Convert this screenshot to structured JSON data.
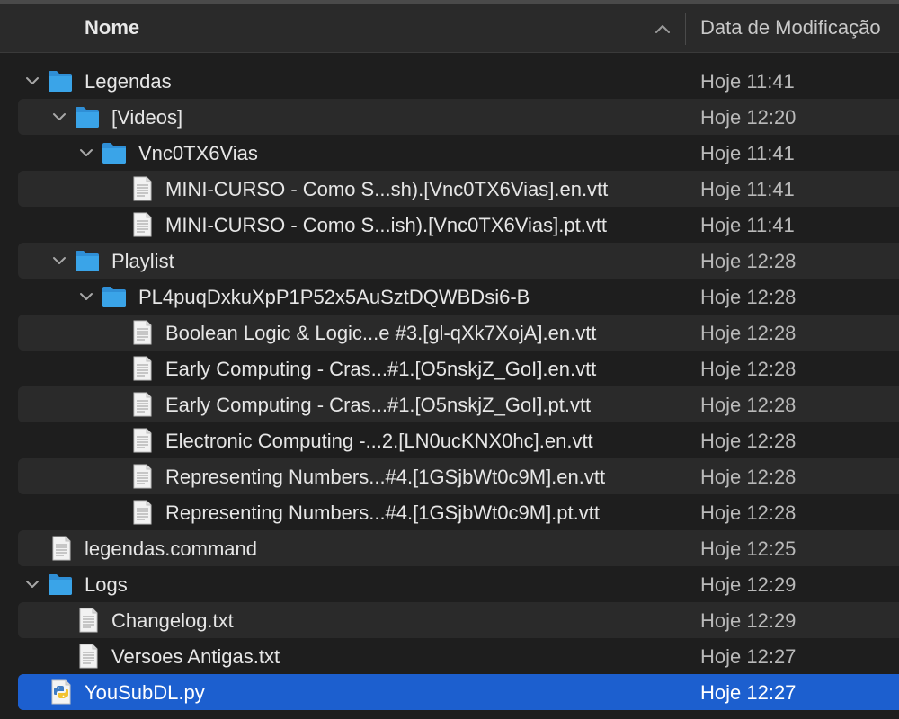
{
  "header": {
    "name_label": "Nome",
    "date_label": "Data de Modificação",
    "sort_icon": "chevron-up-icon"
  },
  "colors": {
    "background": "#1e1e1e",
    "alt_row": "#2a2a2a",
    "selection": "#1c5fcf",
    "folder": "#3aa4e8"
  },
  "rows": [
    {
      "name": "Legendas",
      "date": "Hoje 11:41",
      "kind": "folder",
      "expanded": true
    },
    {
      "name": "[Videos]",
      "date": "Hoje 12:20",
      "kind": "folder",
      "expanded": true
    },
    {
      "name": "Vnc0TX6Vias",
      "date": "Hoje 11:41",
      "kind": "folder",
      "expanded": true
    },
    {
      "name": "MINI-CURSO - Como S...sh).[Vnc0TX6Vias].en.vtt",
      "date": "Hoje 11:41",
      "kind": "document"
    },
    {
      "name": "MINI-CURSO - Como S...ish).[Vnc0TX6Vias].pt.vtt",
      "date": "Hoje 11:41",
      "kind": "document"
    },
    {
      "name": "Playlist",
      "date": "Hoje 12:28",
      "kind": "folder",
      "expanded": true
    },
    {
      "name": "PL4puqDxkuXpP1P52x5AuSztDQWBDsi6-B",
      "date": "Hoje 12:28",
      "kind": "folder",
      "expanded": true
    },
    {
      "name": "Boolean Logic & Logic...e #3.[gl-qXk7XojA].en.vtt",
      "date": "Hoje 12:28",
      "kind": "document"
    },
    {
      "name": "Early Computing - Cras...#1.[O5nskjZ_GoI].en.vtt",
      "date": "Hoje 12:28",
      "kind": "document"
    },
    {
      "name": "Early Computing - Cras...#1.[O5nskjZ_GoI].pt.vtt",
      "date": "Hoje 12:28",
      "kind": "document"
    },
    {
      "name": "Electronic Computing -...2.[LN0ucKNX0hc].en.vtt",
      "date": "Hoje 12:28",
      "kind": "document"
    },
    {
      "name": "Representing Numbers...#4.[1GSjbWt0c9M].en.vtt",
      "date": "Hoje 12:28",
      "kind": "document"
    },
    {
      "name": "Representing Numbers...#4.[1GSjbWt0c9M].pt.vtt",
      "date": "Hoje 12:28",
      "kind": "document"
    },
    {
      "name": "legendas.command",
      "date": "Hoje 12:25",
      "kind": "document"
    },
    {
      "name": "Logs",
      "date": "Hoje 12:29",
      "kind": "folder",
      "expanded": true
    },
    {
      "name": "Changelog.txt",
      "date": "Hoje 12:29",
      "kind": "document"
    },
    {
      "name": "Versoes Antigas.txt",
      "date": "Hoje 12:27",
      "kind": "document"
    },
    {
      "name": "YouSubDL.py",
      "date": "Hoje 12:27",
      "kind": "python",
      "selected": true
    }
  ]
}
